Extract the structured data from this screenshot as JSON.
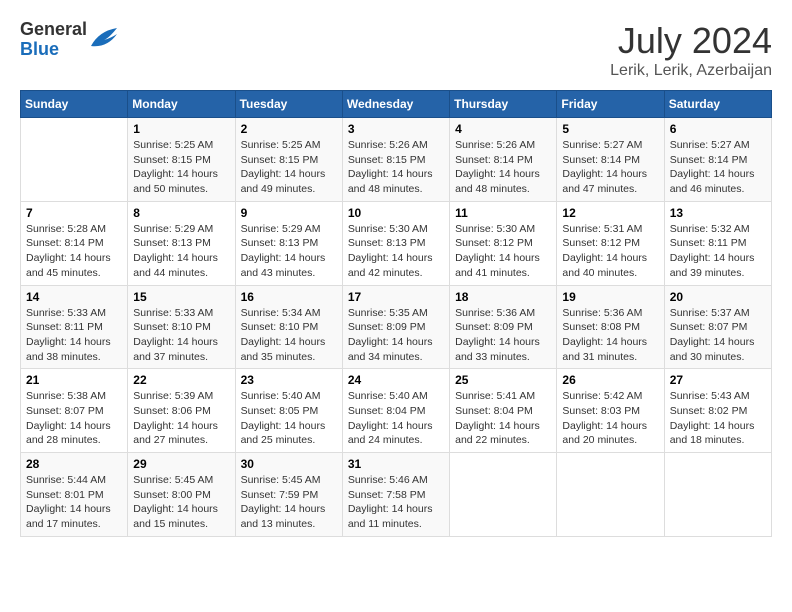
{
  "header": {
    "logo_general": "General",
    "logo_blue": "Blue",
    "month_year": "July 2024",
    "location": "Lerik, Lerik, Azerbaijan"
  },
  "weekdays": [
    "Sunday",
    "Monday",
    "Tuesday",
    "Wednesday",
    "Thursday",
    "Friday",
    "Saturday"
  ],
  "weeks": [
    [
      {
        "day": "",
        "info": ""
      },
      {
        "day": "1",
        "info": "Sunrise: 5:25 AM\nSunset: 8:15 PM\nDaylight: 14 hours\nand 50 minutes."
      },
      {
        "day": "2",
        "info": "Sunrise: 5:25 AM\nSunset: 8:15 PM\nDaylight: 14 hours\nand 49 minutes."
      },
      {
        "day": "3",
        "info": "Sunrise: 5:26 AM\nSunset: 8:15 PM\nDaylight: 14 hours\nand 48 minutes."
      },
      {
        "day": "4",
        "info": "Sunrise: 5:26 AM\nSunset: 8:14 PM\nDaylight: 14 hours\nand 48 minutes."
      },
      {
        "day": "5",
        "info": "Sunrise: 5:27 AM\nSunset: 8:14 PM\nDaylight: 14 hours\nand 47 minutes."
      },
      {
        "day": "6",
        "info": "Sunrise: 5:27 AM\nSunset: 8:14 PM\nDaylight: 14 hours\nand 46 minutes."
      }
    ],
    [
      {
        "day": "7",
        "info": "Sunrise: 5:28 AM\nSunset: 8:14 PM\nDaylight: 14 hours\nand 45 minutes."
      },
      {
        "day": "8",
        "info": "Sunrise: 5:29 AM\nSunset: 8:13 PM\nDaylight: 14 hours\nand 44 minutes."
      },
      {
        "day": "9",
        "info": "Sunrise: 5:29 AM\nSunset: 8:13 PM\nDaylight: 14 hours\nand 43 minutes."
      },
      {
        "day": "10",
        "info": "Sunrise: 5:30 AM\nSunset: 8:13 PM\nDaylight: 14 hours\nand 42 minutes."
      },
      {
        "day": "11",
        "info": "Sunrise: 5:30 AM\nSunset: 8:12 PM\nDaylight: 14 hours\nand 41 minutes."
      },
      {
        "day": "12",
        "info": "Sunrise: 5:31 AM\nSunset: 8:12 PM\nDaylight: 14 hours\nand 40 minutes."
      },
      {
        "day": "13",
        "info": "Sunrise: 5:32 AM\nSunset: 8:11 PM\nDaylight: 14 hours\nand 39 minutes."
      }
    ],
    [
      {
        "day": "14",
        "info": "Sunrise: 5:33 AM\nSunset: 8:11 PM\nDaylight: 14 hours\nand 38 minutes."
      },
      {
        "day": "15",
        "info": "Sunrise: 5:33 AM\nSunset: 8:10 PM\nDaylight: 14 hours\nand 37 minutes."
      },
      {
        "day": "16",
        "info": "Sunrise: 5:34 AM\nSunset: 8:10 PM\nDaylight: 14 hours\nand 35 minutes."
      },
      {
        "day": "17",
        "info": "Sunrise: 5:35 AM\nSunset: 8:09 PM\nDaylight: 14 hours\nand 34 minutes."
      },
      {
        "day": "18",
        "info": "Sunrise: 5:36 AM\nSunset: 8:09 PM\nDaylight: 14 hours\nand 33 minutes."
      },
      {
        "day": "19",
        "info": "Sunrise: 5:36 AM\nSunset: 8:08 PM\nDaylight: 14 hours\nand 31 minutes."
      },
      {
        "day": "20",
        "info": "Sunrise: 5:37 AM\nSunset: 8:07 PM\nDaylight: 14 hours\nand 30 minutes."
      }
    ],
    [
      {
        "day": "21",
        "info": "Sunrise: 5:38 AM\nSunset: 8:07 PM\nDaylight: 14 hours\nand 28 minutes."
      },
      {
        "day": "22",
        "info": "Sunrise: 5:39 AM\nSunset: 8:06 PM\nDaylight: 14 hours\nand 27 minutes."
      },
      {
        "day": "23",
        "info": "Sunrise: 5:40 AM\nSunset: 8:05 PM\nDaylight: 14 hours\nand 25 minutes."
      },
      {
        "day": "24",
        "info": "Sunrise: 5:40 AM\nSunset: 8:04 PM\nDaylight: 14 hours\nand 24 minutes."
      },
      {
        "day": "25",
        "info": "Sunrise: 5:41 AM\nSunset: 8:04 PM\nDaylight: 14 hours\nand 22 minutes."
      },
      {
        "day": "26",
        "info": "Sunrise: 5:42 AM\nSunset: 8:03 PM\nDaylight: 14 hours\nand 20 minutes."
      },
      {
        "day": "27",
        "info": "Sunrise: 5:43 AM\nSunset: 8:02 PM\nDaylight: 14 hours\nand 18 minutes."
      }
    ],
    [
      {
        "day": "28",
        "info": "Sunrise: 5:44 AM\nSunset: 8:01 PM\nDaylight: 14 hours\nand 17 minutes."
      },
      {
        "day": "29",
        "info": "Sunrise: 5:45 AM\nSunset: 8:00 PM\nDaylight: 14 hours\nand 15 minutes."
      },
      {
        "day": "30",
        "info": "Sunrise: 5:45 AM\nSunset: 7:59 PM\nDaylight: 14 hours\nand 13 minutes."
      },
      {
        "day": "31",
        "info": "Sunrise: 5:46 AM\nSunset: 7:58 PM\nDaylight: 14 hours\nand 11 minutes."
      },
      {
        "day": "",
        "info": ""
      },
      {
        "day": "",
        "info": ""
      },
      {
        "day": "",
        "info": ""
      }
    ]
  ]
}
